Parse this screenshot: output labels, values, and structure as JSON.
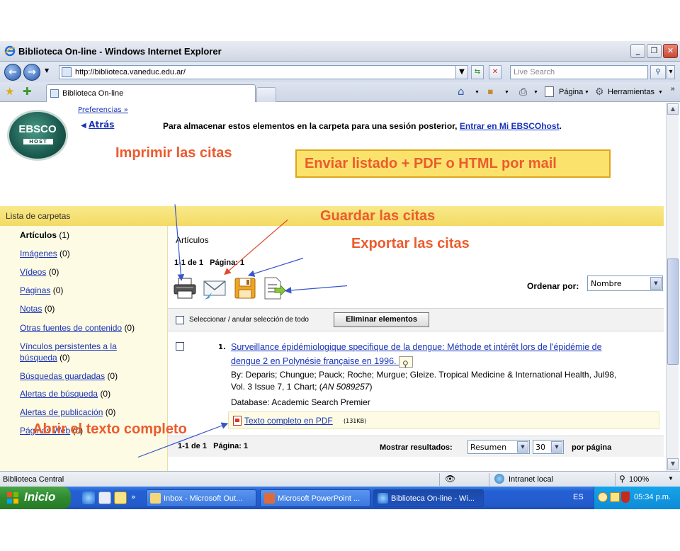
{
  "window": {
    "title": "Biblioteca On-line - Windows Internet Explorer",
    "minimize": "_",
    "restore": "❐",
    "close": "✕"
  },
  "address": {
    "url": "http://biblioteca.vaneduc.edu.ar/",
    "search_placeholder": "Live Search"
  },
  "tabs": {
    "active_label": "Biblioteca On-line",
    "page_menu": "Página",
    "tools_menu": "Herramientas"
  },
  "header": {
    "logo_text": "EBSCO",
    "logo_sub": "HOST",
    "preferences": "Preferencias »",
    "back": "Atrás",
    "save_message": "Para almacenar estos elementos en la carpeta para una sesión posterior,",
    "save_link": "Entrar en Mi EBSCOhost",
    "save_end": "."
  },
  "sidebar": {
    "title": "Lista de carpetas",
    "items": [
      {
        "label": "Artículos",
        "count": "(1)",
        "active": true
      },
      {
        "label": "Imágenes",
        "count": "(0)"
      },
      {
        "label": "Vídeos",
        "count": "(0)"
      },
      {
        "label": "Páginas",
        "count": "(0)"
      },
      {
        "label": "Notas",
        "count": "(0)"
      },
      {
        "label": "Otras fuentes de contenido",
        "count": "(0)"
      },
      {
        "label": "Vínculos persistentes a la",
        "label2": "búsqueda",
        "count": "(0)"
      },
      {
        "label": "Búsquedas guardadas",
        "count": "(0)"
      },
      {
        "label": "Alertas de búsqueda",
        "count": "(0)"
      },
      {
        "label": "Alertas de publicación",
        "count": "(0)"
      },
      {
        "label": "Páginas Web",
        "count": "(0)"
      }
    ]
  },
  "main": {
    "title": "Artículos",
    "paging_top": "1-1 de 1   Página: 1",
    "sort_label": "Ordenar por:",
    "sort_value": "Nombre",
    "select_all": "Seleccionar / anular selección de todo",
    "delete_button": "Eliminar elementos",
    "result": {
      "number": "1.",
      "title": "Surveillance épidémiologique specifique de la dengue: Méthode et intérêt lors de l'épidémie de dengue 2 en Polynésie française en 1996.",
      "meta_line1": "By: Deparis; Chungue; Pauck; Roche; Murgue; Gleize. Tropical Medicine & International Health, Jul98,",
      "meta_line2_pre": "Vol. 3 Issue 7, 1 Chart; (",
      "meta_an": "AN 5089257",
      "meta_line2_post": ")",
      "database": "Database: Academic Search Premier",
      "pdf_link": "Texto completo en PDF",
      "pdf_size": "(131KB)"
    },
    "paging_bottom": "1-1 de 1   Página: 1",
    "show_results_label": "Mostrar resultados:",
    "show_results_value": "Resumen",
    "per_page_value": "30",
    "per_page_label": "por página"
  },
  "annotations": {
    "print": "Imprimir las citas",
    "email": "Enviar listado + PDF o HTML por mail",
    "save": "Guardar las citas",
    "export": "Exportar las citas",
    "fulltext": "Abrir el texto completo",
    "color": "#ec5b2d",
    "box_color": "#fbe26c"
  },
  "statusbar": {
    "text": "Biblioteca Central",
    "zone": "Intranet local",
    "zoom": "100%"
  },
  "taskbar": {
    "start": "Inicio",
    "tasks": [
      "Inbox - Microsoft Out...",
      "Microsoft PowerPoint ...",
      "Biblioteca On-line - Wi..."
    ],
    "lang": "ES",
    "clock": "05:34 p.m."
  }
}
